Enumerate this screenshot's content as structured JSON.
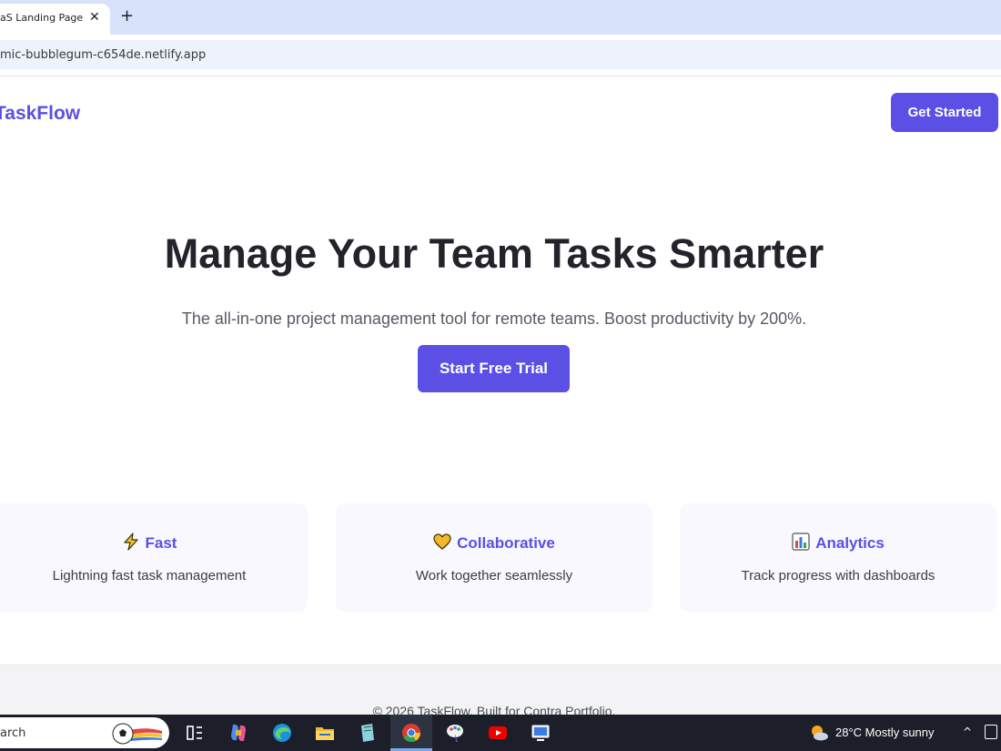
{
  "browser": {
    "tab_title": "aS Landing Page",
    "tab_close_glyph": "✕",
    "new_tab_glyph": "+",
    "url": "mic-bubblegum-c654de.netlify.app"
  },
  "nav": {
    "logo": "TaskFlow",
    "cta_label": "Get Started"
  },
  "hero": {
    "title": "Manage Your Team Tasks Smarter",
    "subtitle": "The all-in-one project management tool for remote teams. Boost productivity by 200%.",
    "cta_label": "Start Free Trial"
  },
  "features": [
    {
      "icon": "lightning-icon",
      "title": "Fast",
      "description": "Lightning fast task management"
    },
    {
      "icon": "heart-icon",
      "title": "Collaborative",
      "description": "Work together seamlessly"
    },
    {
      "icon": "bar-chart-icon",
      "title": "Analytics",
      "description": "Track progress with dashboards"
    }
  ],
  "footer": {
    "text": "© 2026 TaskFlow. Built for Contra Portfolio."
  },
  "taskbar": {
    "search_text": "arch",
    "weather": "28°C  Mostly sunny",
    "chevron_glyph": "^"
  },
  "colors": {
    "brand": "#5b4fe6",
    "heading": "#23232b",
    "tabbar": "#d8e3fb",
    "taskbar": "#1c1f2a"
  }
}
